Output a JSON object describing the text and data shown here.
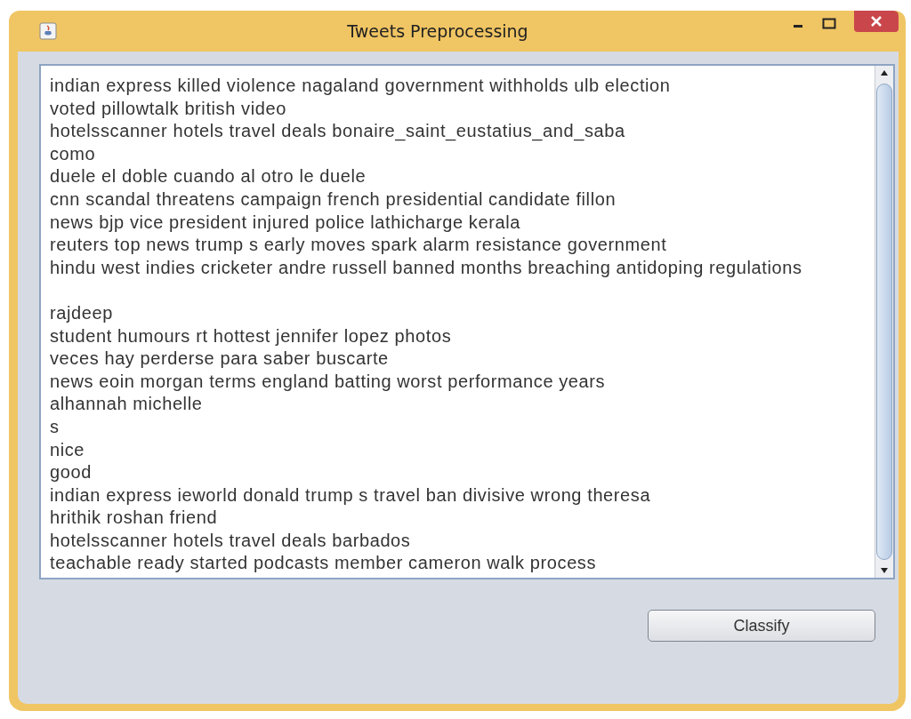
{
  "window": {
    "title": "Tweets Preprocessing"
  },
  "text_area": {
    "paragraphs": [
      {
        "lines": [
          "indian express killed violence nagaland government withholds ulb election",
          "voted pillowtalk british video",
          "hotelsscanner hotels travel deals bonaire_saint_eustatius_and_saba",
          "como",
          "duele el doble cuando al otro le duele",
          "cnn scandal threatens campaign french presidential candidate fillon",
          "news bjp vice president injured police lathicharge kerala",
          "reuters top news trump s early moves spark alarm resistance government",
          "hindu west indies cricketer andre russell banned months breaching antidoping regulations"
        ]
      },
      {
        "lines": [
          "rajdeep",
          "student humours rt hottest jennifer lopez photos",
          "veces hay perderse para saber buscarte",
          "news eoin morgan terms england batting worst performance years",
          "alhannah michelle",
          "s",
          "nice",
          "good",
          "indian express ieworld donald trump s travel ban divisive wrong theresa",
          "hrithik roshan friend",
          "hotelsscanner hotels travel deals barbados",
          "teachable ready started podcasts member cameron walk process"
        ]
      }
    ]
  },
  "buttons": [
    {
      "label": "Classify"
    }
  ]
}
